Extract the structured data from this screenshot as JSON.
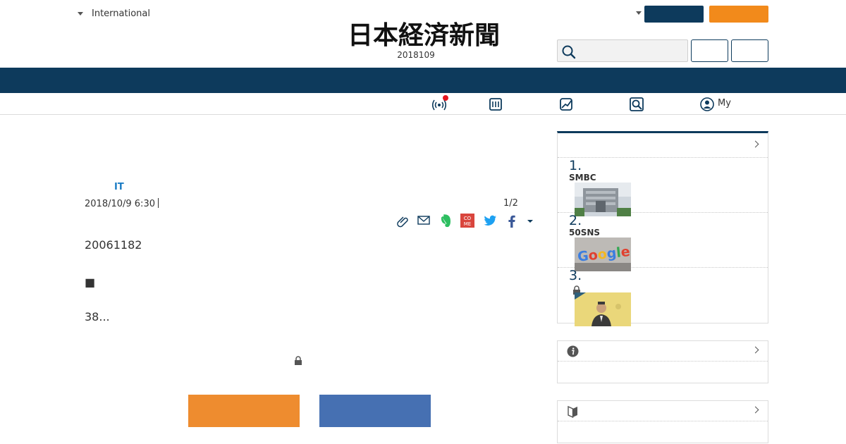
{
  "header": {
    "edition_label": "International",
    "logo_text": "日本経済新聞",
    "date": "2018109"
  },
  "subnav": {
    "my_label": "My"
  },
  "article": {
    "category": "IT",
    "datetime": "2018/10/9 6:30",
    "pager": "1/2",
    "paragraphs": [
      "20061182",
      "■",
      "38..."
    ]
  },
  "ranking": {
    "items": [
      {
        "num": "1.",
        "title": "SMBC"
      },
      {
        "num": "2.",
        "title": "50SNS"
      },
      {
        "num": "3.",
        "title": ""
      }
    ]
  },
  "colors": {
    "navy": "#0d3a5c",
    "orange": "#f28a1b",
    "link_blue": "#1b7cc4",
    "cta_orange": "#ee8c2f",
    "cta_blue": "#4670b2"
  },
  "icons": [
    "caret-down-icon",
    "search-icon",
    "broadcast-icon",
    "newspaper-icon",
    "chart-icon",
    "search-box-icon",
    "user-icon",
    "clip-icon",
    "mail-icon",
    "evernote-icon",
    "comment-icon",
    "twitter-icon",
    "facebook-icon",
    "lock-icon",
    "info-icon",
    "beginner-icon",
    "chevron-right-icon"
  ]
}
